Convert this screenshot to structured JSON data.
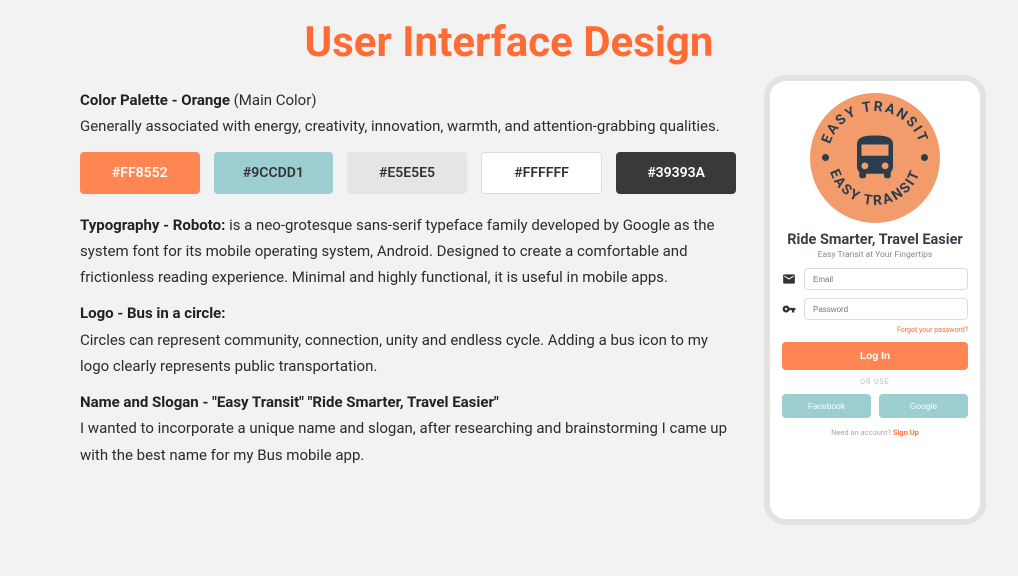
{
  "title": "User Interface Design",
  "color_section": {
    "heading_bold": "Color Palette - Orange",
    "heading_rest": " (Main Color)",
    "body": "Generally associated with energy, creativity, innovation, warmth, and attention-grabbing qualities."
  },
  "swatches": [
    {
      "hex": "#FF8552"
    },
    {
      "hex": "#9CCDD1"
    },
    {
      "hex": "#E5E5E5"
    },
    {
      "hex": "#FFFFFF"
    },
    {
      "hex": "#39393A"
    }
  ],
  "typography": {
    "heading": "Typography - Roboto:",
    "body": " is a neo-grotesque sans-serif typeface family developed by Google as the system font for its mobile operating system, Android. Designed to create a comfortable and frictionless reading experience. Minimal and highly functional, it is useful in mobile apps."
  },
  "logo_section": {
    "heading": "Logo -  Bus in a circle:",
    "body": "Circles can represent community, connection, unity and endless cycle. Adding a bus icon to my logo clearly represents public transportation."
  },
  "name_section": {
    "heading": "Name and Slogan - \"Easy Transit\" \"Ride Smarter, Travel Easier\"",
    "body": "I wanted to incorporate a unique name and slogan, after researching and brainstorming I came up with the best name for my Bus mobile app."
  },
  "mockup": {
    "logo_text_top": "EASY TRANSIT",
    "logo_text_bottom": "EASY TRANSIT",
    "slogan": "Ride Smarter, Travel Easier",
    "sub_slogan": "Easy Transit at Your Fingertips",
    "email_placeholder": "Email",
    "password_placeholder": "Password",
    "forgot": "Forgot your password?",
    "login": "Log In",
    "or_use": "OR USE",
    "facebook": "Facebook",
    "google": "Google",
    "need_account": "Need an account?   ",
    "signup": "Sign Up"
  }
}
